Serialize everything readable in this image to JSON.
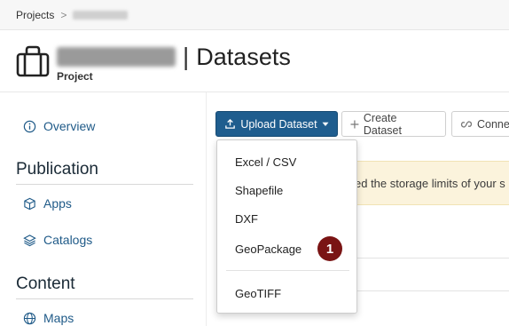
{
  "breadcrumb": {
    "root": "Projects",
    "separator": ">"
  },
  "header": {
    "title_separator": "|",
    "page_title": "Datasets",
    "subtitle": "Project"
  },
  "sidebar": {
    "overview_label": "Overview",
    "sections": [
      {
        "heading": "Publication",
        "items": [
          {
            "label": "Apps",
            "icon": "cube-icon"
          },
          {
            "label": "Catalogs",
            "icon": "layers-icon"
          }
        ]
      },
      {
        "heading": "Content",
        "items": [
          {
            "label": "Maps",
            "icon": "globe-icon"
          }
        ]
      }
    ]
  },
  "toolbar": {
    "upload_label": "Upload Dataset",
    "create_label": "Create Dataset",
    "connect_label": "Conne"
  },
  "warning": {
    "text": "ed the storage limits of your s"
  },
  "dropdown": {
    "items": [
      "Excel / CSV",
      "Shapefile",
      "DXF",
      "GeoPackage",
      "GeoTIFF"
    ]
  },
  "badge": {
    "step": "1"
  },
  "colors": {
    "primary": "#1f5d8e",
    "link": "#1f5a88",
    "badge": "#7a1414",
    "warning_bg": "#fbf3dc"
  }
}
